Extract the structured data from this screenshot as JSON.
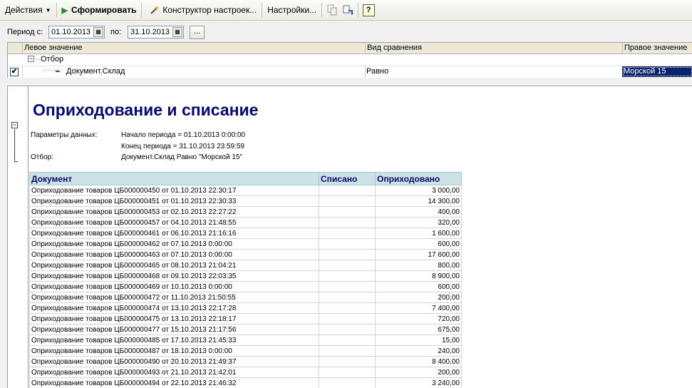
{
  "toolbar": {
    "actions_label": "Действия",
    "generate_label": "Сформировать",
    "constructor_label": "Конструктор настроек...",
    "settings_label": "Настройки...",
    "help_label": "?"
  },
  "period": {
    "from_label": "Период с:",
    "from_value": "01.10.2013",
    "to_label": "по:",
    "to_value": "31.10.2013",
    "more_label": "..."
  },
  "filter": {
    "col_left": "Левое значение",
    "col_compare": "Вид сравнения",
    "col_right": "Правое значение",
    "group_label": "Отбор",
    "row_field": "Документ.Склад",
    "row_compare": "Равно",
    "row_value": "Морской 15"
  },
  "report": {
    "title": "Оприходование и списание",
    "params_label": "Параметры данных:",
    "param_start": "Начало периода = 01.10.2013 0:00:00",
    "param_end": "Конец периода = 31.10.2013 23:59:59",
    "filter_label": "Отбор:",
    "filter_value": "Документ.Склад Равно \"Морской 15\"",
    "col_doc": "Документ",
    "col_written_off": "Списано",
    "col_received": "Оприходовано",
    "rows": [
      {
        "doc": "Оприходование товаров ЦБ000000450 от 01.10.2013 22:30:17",
        "written_off": "",
        "received": "3 000,00"
      },
      {
        "doc": "Оприходование товаров ЦБ000000451 от 01.10.2013 22:30:33",
        "written_off": "",
        "received": "14 300,00"
      },
      {
        "doc": "Оприходование товаров ЦБ000000453 от 02.10.2013 22:27:22",
        "written_off": "",
        "received": "400,00"
      },
      {
        "doc": "Оприходование товаров ЦБ000000457 от 04.10.2013 21:48:55",
        "written_off": "",
        "received": "320,00"
      },
      {
        "doc": "Оприходование товаров ЦБ000000461 от 06.10.2013 21:16:16",
        "written_off": "",
        "received": "1 600,00"
      },
      {
        "doc": "Оприходование товаров ЦБ000000462 от 07.10.2013 0:00:00",
        "written_off": "",
        "received": "600,00"
      },
      {
        "doc": "Оприходование товаров ЦБ000000463 от 07.10.2013 0:00:00",
        "written_off": "",
        "received": "17 600,00"
      },
      {
        "doc": "Оприходование товаров ЦБ000000465 от 08.10.2013 21:04:21",
        "written_off": "",
        "received": "800,00"
      },
      {
        "doc": "Оприходование товаров ЦБ000000468 от 09.10.2013 22:03:35",
        "written_off": "",
        "received": "8 900,00"
      },
      {
        "doc": "Оприходование товаров ЦБ000000469 от 10.10.2013 0:00:00",
        "written_off": "",
        "received": "600,00"
      },
      {
        "doc": "Оприходование товаров ЦБ000000472 от 11.10.2013 21:50:55",
        "written_off": "",
        "received": "200,00"
      },
      {
        "doc": "Оприходование товаров ЦБ000000474 от 13.10.2013 22:17:28",
        "written_off": "",
        "received": "7 400,00"
      },
      {
        "doc": "Оприходование товаров ЦБ000000475 от 13.10.2013 22:18:17",
        "written_off": "",
        "received": "720,00"
      },
      {
        "doc": "Оприходование товаров ЦБ000000477 от 15.10.2013 21:17:56",
        "written_off": "",
        "received": "675,00"
      },
      {
        "doc": "Оприходование товаров ЦБ000000485 от 17.10.2013 21:45:33",
        "written_off": "",
        "received": "15,00"
      },
      {
        "doc": "Оприходование товаров ЦБ000000487 от 18.10.2013 0:00:00",
        "written_off": "",
        "received": "240,00"
      },
      {
        "doc": "Оприходование товаров ЦБ000000490 от 20.10.2013 21:49:37",
        "written_off": "",
        "received": "8 400,00"
      },
      {
        "doc": "Оприходование товаров ЦБ000000493 от 21.10.2013 21:42:01",
        "written_off": "",
        "received": "200,00"
      },
      {
        "doc": "Оприходование товаров ЦБ000000494 от 22.10.2013 21:46:32",
        "written_off": "",
        "received": "3 240,00"
      }
    ]
  }
}
